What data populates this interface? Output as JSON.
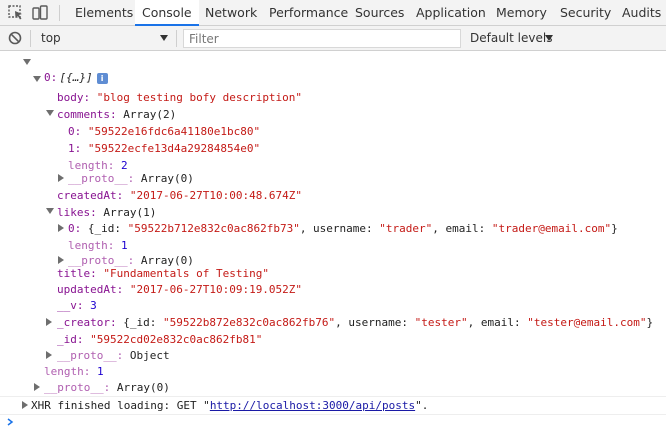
{
  "tabs": [
    {
      "label": "Elements"
    },
    {
      "label": "Console",
      "active": true
    },
    {
      "label": "Network"
    },
    {
      "label": "Performance"
    },
    {
      "label": "Sources"
    },
    {
      "label": "Application"
    },
    {
      "label": "Memory"
    },
    {
      "label": "Security"
    },
    {
      "label": "Audits"
    }
  ],
  "toolbar": {
    "context": "top",
    "filter_placeholder": "Filter",
    "levels": "Default levels"
  },
  "console": {
    "root_label": "[{…}]",
    "info_badge": "i",
    "item0_key": "0:",
    "body": {
      "key": "body:",
      "value": "\"blog testing bofy description\""
    },
    "comments": {
      "key": "comments:",
      "summary": "Array(2)",
      "items": [
        {
          "key": "0:",
          "value": "\"59522e16fdc6a41180e1bc80\""
        },
        {
          "key": "1:",
          "value": "\"59522ecfe13d4a29284854e0\""
        }
      ],
      "length_key": "length:",
      "length": "2",
      "proto_key": "__proto__:",
      "proto": "Array(0)"
    },
    "createdAt": {
      "key": "createdAt:",
      "value": "\"2017-06-27T10:00:48.674Z\""
    },
    "likes": {
      "key": "likes:",
      "summary": "Array(1)",
      "item0_key": "0:",
      "item0_open": "{_id: ",
      "item0_id": "\"59522b712e832c0ac862fb73\"",
      "item0_sep1": ", username: ",
      "item0_username": "\"trader\"",
      "item0_sep2": ", email: ",
      "item0_email": "\"trader@email.com\"",
      "item0_close": "}",
      "length_key": "length:",
      "length": "1",
      "proto_key": "__proto__:",
      "proto": "Array(0)"
    },
    "title": {
      "key": "title:",
      "value": "\"Fundamentals of Testing\""
    },
    "updatedAt": {
      "key": "updatedAt:",
      "value": "\"2017-06-27T10:09:19.052Z\""
    },
    "v": {
      "key": "__v:",
      "value": "3"
    },
    "creator": {
      "key": "_creator:",
      "open": "{_id: ",
      "id": "\"59522b872e832c0ac862fb76\"",
      "sep1": ", username: ",
      "username": "\"tester\"",
      "sep2": ", email: ",
      "email": "\"tester@email.com\"",
      "close": "}"
    },
    "id": {
      "key": "_id:",
      "value": "\"59522cd02e832c0ac862fb81\""
    },
    "item_proto": {
      "key": "__proto__:",
      "value": "Object"
    },
    "root_length": {
      "key": "length:",
      "value": "1"
    },
    "root_proto": {
      "key": "__proto__:",
      "value": "Array(0)"
    },
    "xhr": {
      "prefix": "XHR finished loading: GET \"",
      "url": "http://localhost:3000/api/posts",
      "suffix": "\"."
    }
  }
}
